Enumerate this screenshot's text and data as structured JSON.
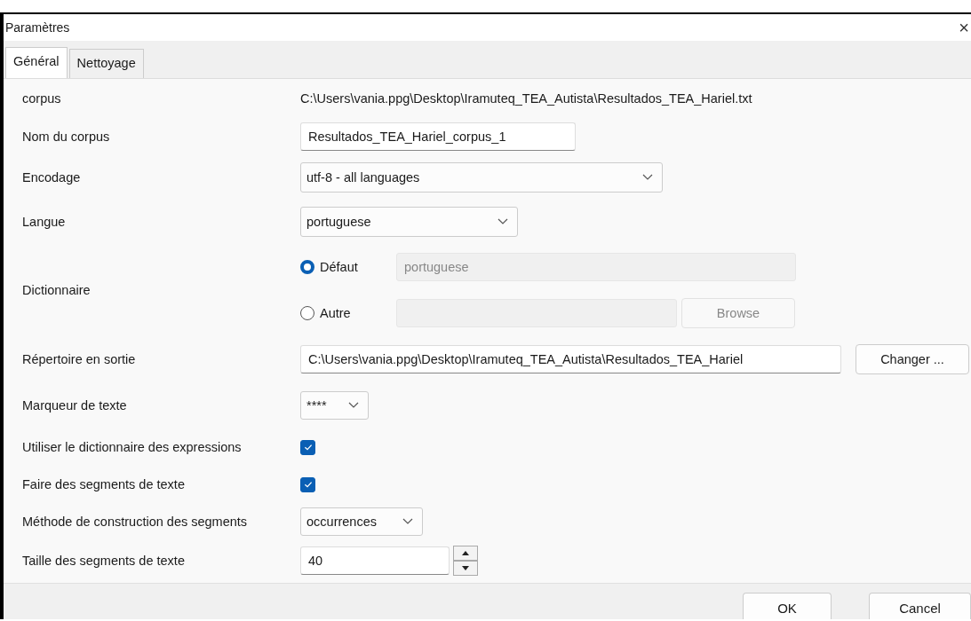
{
  "window": {
    "title": "Paramètres",
    "close": "×"
  },
  "tabs": [
    {
      "label": "Général",
      "selected": true
    },
    {
      "label": "Nettoyage",
      "selected": false
    }
  ],
  "fields": [
    {
      "kind": "text",
      "label": "corpus",
      "value": "C:\\Users\\vania.ppg\\Desktop\\Iramuteq_TEA_Autista\\Resultados_TEA_Hariel.txt"
    },
    {
      "kind": "input",
      "label": "Nom du corpus",
      "value": "Resultados_TEA_Hariel_corpus_1"
    },
    {
      "kind": "select",
      "label": "Encodage",
      "value": "utf-8 - all languages"
    },
    {
      "kind": "select",
      "label": "Langue",
      "value": "portuguese"
    },
    {
      "kind": "radio",
      "label": "Dictionnaire",
      "options": [
        {
          "label": "Défaut",
          "selected": true,
          "field": {
            "value": "portuguese",
            "disabled": true
          }
        },
        {
          "label": "Autre",
          "selected": false,
          "field": {
            "disabled": true
          },
          "button": {
            "label": "Browse",
            "disabled": true
          }
        }
      ]
    },
    {
      "kind": "path",
      "label": "Répertoire en sortie",
      "value": "C:\\Users\\vania.ppg\\Desktop\\Iramuteq_TEA_Autista\\Resultados_TEA_Hariel",
      "button": "Changer ..."
    },
    {
      "kind": "select",
      "label": "Marqueur de texte",
      "value": "****"
    },
    {
      "kind": "checkbox",
      "label": "Utiliser le dictionnaire des expressions",
      "checked": true
    },
    {
      "kind": "checkbox",
      "label": "Faire des segments de texte",
      "checked": true
    },
    {
      "kind": "select",
      "label": "Méthode de construction des segments",
      "value": "occurrences"
    },
    {
      "kind": "spin",
      "label": "Taille des segments de texte",
      "value": "40"
    }
  ],
  "buttons": [
    "OK",
    "Cancel"
  ]
}
